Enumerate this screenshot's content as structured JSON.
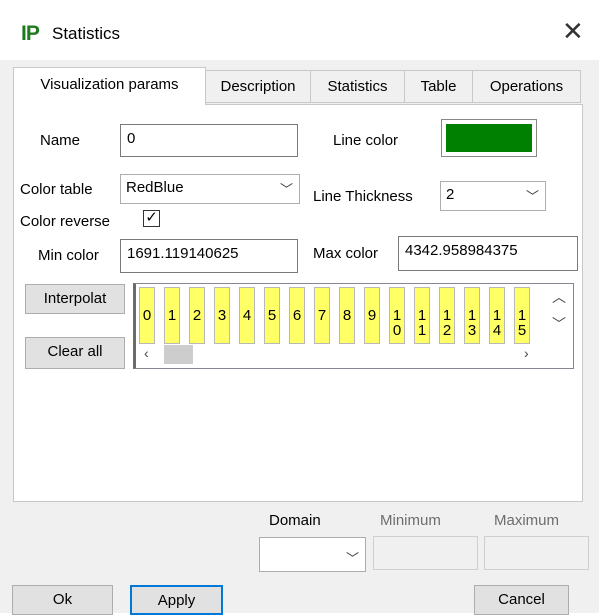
{
  "window": {
    "logo": "IP",
    "title": "Statistics"
  },
  "tabs": [
    {
      "label": "Visualization params",
      "active": true
    },
    {
      "label": "Description",
      "active": false
    },
    {
      "label": "Statistics",
      "active": false
    },
    {
      "label": "Table",
      "active": false
    },
    {
      "label": "Operations",
      "active": false
    }
  ],
  "form": {
    "name_label": "Name",
    "name_value": "0",
    "line_color_label": "Line color",
    "line_color": "#008000",
    "color_table_label": "Color table",
    "color_table_value": "RedBlue",
    "line_thickness_label": "Line Thickness",
    "line_thickness_value": "2",
    "color_reverse_label": "Color reverse",
    "color_reverse_checked": true,
    "min_color_label": "Min color",
    "min_color_value": "1691.119140625",
    "max_color_label": "Max color",
    "max_color_value": "4342.958984375"
  },
  "buttons": {
    "interpolate": "Interpolat",
    "clear_all": "Clear all",
    "ok": "Ok",
    "apply": "Apply",
    "cancel": "Cancel"
  },
  "color_cells": [
    "0",
    "1",
    "2",
    "3",
    "4",
    "5",
    "6",
    "7",
    "8",
    "9",
    "1\n0",
    "1\n1",
    "1\n2",
    "1\n3",
    "1\n4",
    "1\n5"
  ],
  "cell_color": "#ffff66",
  "domain": {
    "label": "Domain",
    "minimum_label": "Minimum",
    "maximum_label": "Maximum"
  }
}
